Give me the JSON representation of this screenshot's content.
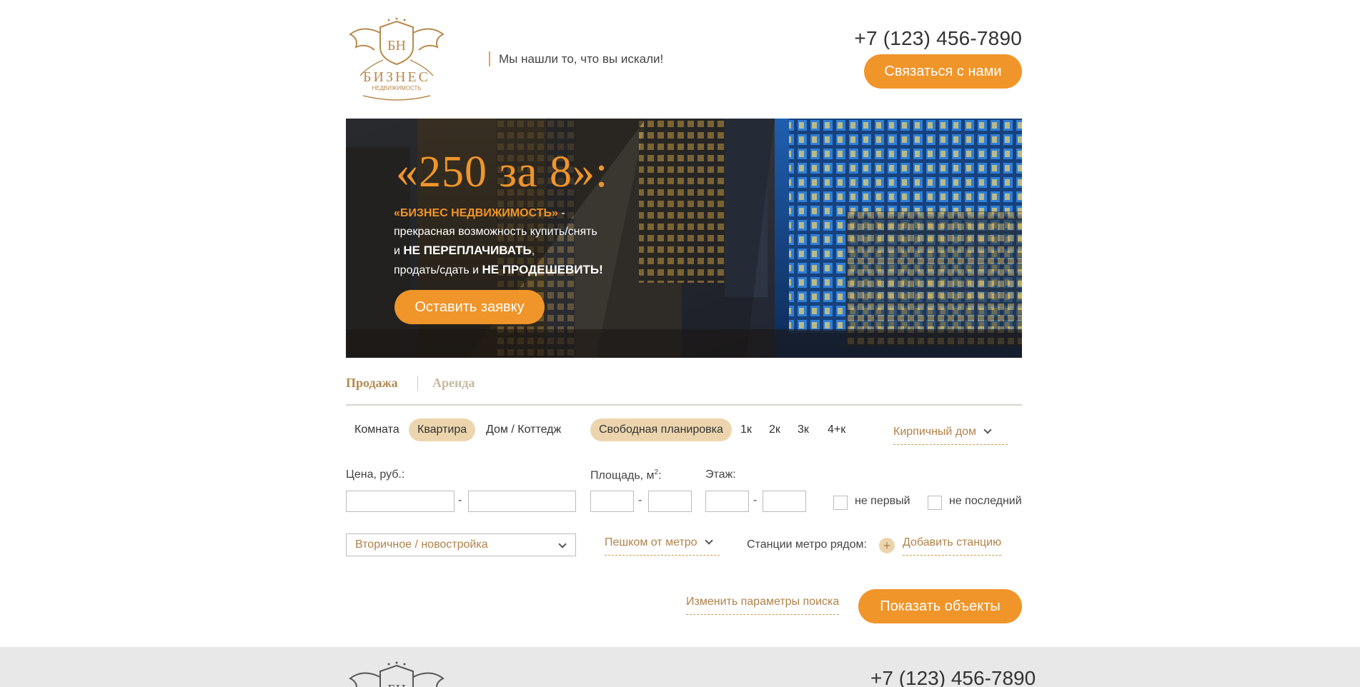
{
  "header": {
    "logo_initials": "БН",
    "logo_title": "БИЗНЕС",
    "logo_subtitle": "НЕДВИЖИМОСТЬ",
    "tagline": "Мы нашли то, что вы искали!",
    "phone": "+7 (123) 456-7890",
    "contact_button": "Связаться с нами"
  },
  "banner": {
    "title": "«250 за 8»:",
    "line1_highlight": "«БИЗНЕС НЕДВИЖИМОСТЬ»",
    "line1_rest": " -",
    "line2": "прекрасная возможность купить/снять",
    "line3_pre": "и ",
    "line3_bold": "НЕ ПЕРЕПЛАЧИВАТЬ",
    "line3_post": ",",
    "line4_pre": "продать/сдать и ",
    "line4_bold": "НЕ ПРОДЕШЕВИТЬ!",
    "apply_button": "Оставить заявку"
  },
  "tabs": {
    "sale": "Продажа",
    "rent": "Аренда"
  },
  "filters": {
    "property_types": [
      "Комната",
      "Квартира",
      "Дом / Коттедж"
    ],
    "layout": "Свободная планировка",
    "rooms": [
      "1к",
      "2к",
      "3к",
      "4+к"
    ],
    "building_type": "Кирпичный дом",
    "price_label": "Цена, руб.:",
    "area_label": "Площадь, м",
    "area_sup": "2",
    "area_colon": ":",
    "floor_label": "Этаж:",
    "dash": "-",
    "not_first": "не первый",
    "not_last": "не последний",
    "market": "Вторичное / новостройка",
    "walk_metro": "Пешком от метро",
    "metro_nearby": "Станции метро рядом:",
    "plus": "+",
    "add_station": "Добавить станцию"
  },
  "actions": {
    "change_params": "Изменить параметры поиска",
    "show_objects": "Показать объекты"
  },
  "footer": {
    "phone": "+7 (123) 456-7890"
  },
  "colors": {
    "accent": "#f0952a",
    "accent_light": "#ecd5ae",
    "link": "#b0824a",
    "logo_gold": "#b88a4e"
  }
}
